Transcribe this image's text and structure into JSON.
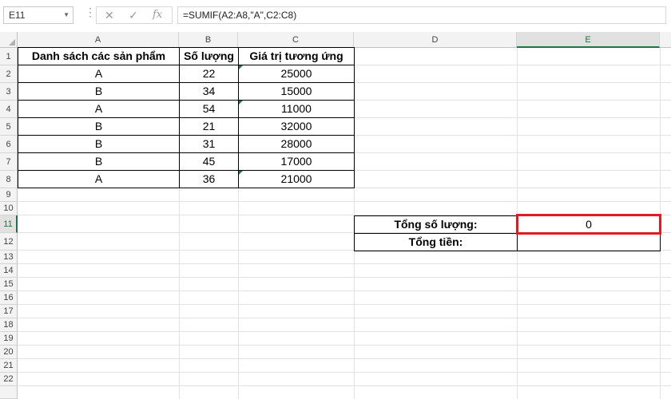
{
  "formula_bar": {
    "name_box": "E11",
    "cancel_glyph": "✕",
    "enter_glyph": "✓",
    "fx_glyph": "fx",
    "formula": "=SUMIF(A2:A8,\"A\",C2:C8)"
  },
  "columns": [
    "A",
    "B",
    "C",
    "D",
    "E"
  ],
  "rows": [
    "1",
    "2",
    "3",
    "4",
    "5",
    "6",
    "7",
    "8",
    "9",
    "10",
    "11",
    "12",
    "13",
    "14",
    "15",
    "16",
    "17",
    "18",
    "19",
    "20",
    "21",
    "22"
  ],
  "table": {
    "headers": [
      "Danh sách các sản phẩm",
      "Số lượng",
      "Giá trị tương ứng"
    ],
    "rows": [
      [
        "A",
        "22",
        "25000"
      ],
      [
        "B",
        "34",
        "15000"
      ],
      [
        "A",
        "54",
        "11000"
      ],
      [
        "B",
        "21",
        "32000"
      ],
      [
        "B",
        "31",
        "28000"
      ],
      [
        "B",
        "45",
        "17000"
      ],
      [
        "A",
        "36",
        "21000"
      ]
    ]
  },
  "summary": {
    "total_qty_label": "Tổng số lượng:",
    "total_qty_value": "0",
    "total_money_label": "Tổng tiền:",
    "total_money_value": ""
  },
  "colors": {
    "highlight": "#e01b24",
    "accent": "#217346",
    "error_indicator": "#1e7a3a"
  }
}
